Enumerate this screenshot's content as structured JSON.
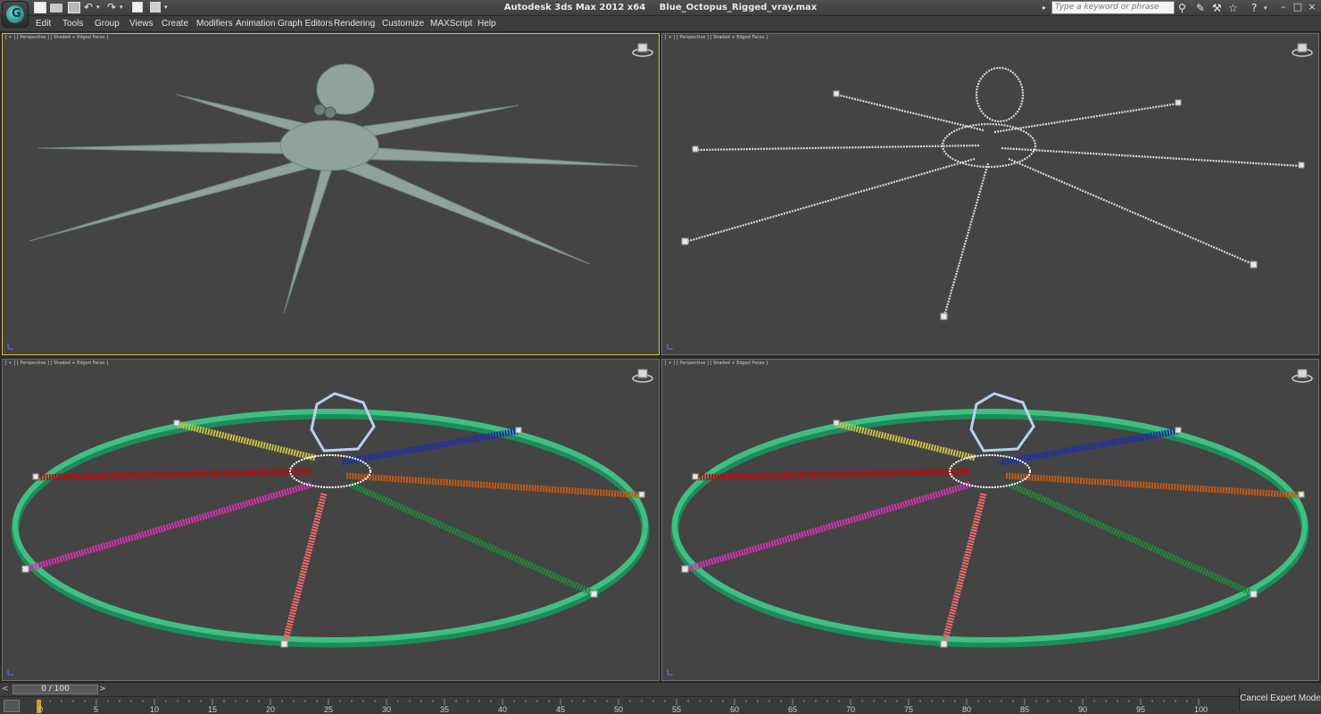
{
  "titlebar": {
    "app_name": "Autodesk 3ds Max  2012 x64",
    "file_name": "Blue_Octopus_Rigged_vray.max",
    "logo_letter": "G",
    "search_placeholder": "Type a keyword or phrase",
    "help_glyph": "?",
    "minimize": "–",
    "maximize": "□",
    "close": "×"
  },
  "menu": [
    "Edit",
    "Tools",
    "Group",
    "Views",
    "Create",
    "Modifiers",
    "Animation",
    "Graph Editors",
    "Rendering",
    "Customize",
    "MAXScript",
    "Help"
  ],
  "viewports": [
    {
      "label": "[ + ] [ Perspective ] [ Shaded + Edged Faces ]",
      "mode": "shaded",
      "active": true
    },
    {
      "label": "[ + ] [ Perspective ] [ Shaded + Edged Faces ]",
      "mode": "wire",
      "active": false
    },
    {
      "label": "[ + ] [ Perspective ] [ Shaded + Edged Faces ]",
      "mode": "rig",
      "active": false
    },
    {
      "label": "[ + ] [ Perspective ] [ Shaded + Edged Faces ]",
      "mode": "rig",
      "active": false
    }
  ],
  "colors": {
    "viewport_bg": "#444444",
    "active_border": "#d9b733",
    "octopus_skin": "#8fa39b",
    "control_ring": "#3fbf85",
    "tentacles": [
      "#c8c043",
      "#1e2fa8",
      "#b01010",
      "#c45a12",
      "#d431b0",
      "#1c8c3c",
      "#f06a6a",
      "#ffffff"
    ]
  },
  "timeslider": {
    "frame": "0 / 100",
    "prev": "<",
    "next": ">"
  },
  "trackbar": {
    "ticks": [
      "0",
      "5",
      "10",
      "15",
      "20",
      "25",
      "30",
      "35",
      "40",
      "45",
      "50",
      "55",
      "60",
      "65",
      "70",
      "75",
      "80",
      "85",
      "90",
      "95",
      "100"
    ]
  },
  "cancel_expert_mode": "Cancel Expert Mode"
}
